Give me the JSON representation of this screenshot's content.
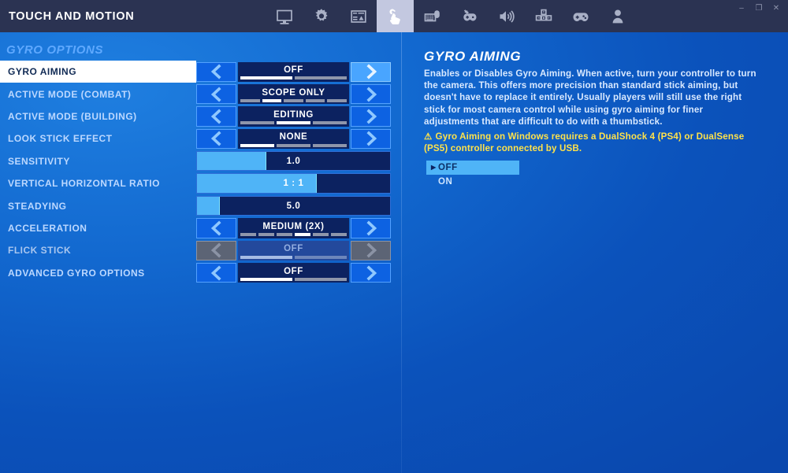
{
  "window": {
    "title": "TOUCH AND MOTION",
    "controls": [
      {
        "name": "minimize",
        "glyph": "–"
      },
      {
        "name": "maximize",
        "glyph": "❐"
      },
      {
        "name": "close",
        "glyph": "✕"
      }
    ]
  },
  "tabs": [
    {
      "icon": "monitor-icon",
      "label": "Video",
      "selected": false
    },
    {
      "icon": "gear-icon",
      "label": "Game",
      "selected": false
    },
    {
      "icon": "hud-layout-icon",
      "label": "HUD Layout",
      "selected": false
    },
    {
      "icon": "touch-hand-icon",
      "label": "Touch and Motion",
      "selected": true
    },
    {
      "icon": "keyboard-mouse-icon",
      "label": "Keyboard and Mouse",
      "selected": false
    },
    {
      "icon": "controller-settings-icon",
      "label": "Controller Settings",
      "selected": false
    },
    {
      "icon": "audio-speaker-icon",
      "label": "Audio",
      "selected": false
    },
    {
      "icon": "keybinds-icon",
      "label": "Key Bindings",
      "selected": false
    },
    {
      "icon": "gamepad-icon",
      "label": "Controller",
      "selected": false
    },
    {
      "icon": "account-person-icon",
      "label": "Account",
      "selected": false
    }
  ],
  "settings": {
    "section_title": "GYRO OPTIONS",
    "rows": [
      {
        "label": "GYRO AIMING",
        "type": "stepper",
        "value": "OFF",
        "segments": 2,
        "active_segment": 1,
        "selected": true,
        "disabled": false,
        "right_arrow_hot": true
      },
      {
        "label": "ACTIVE MODE (COMBAT)",
        "type": "stepper",
        "value": "SCOPE ONLY",
        "segments": 5,
        "active_segment": 2,
        "selected": false,
        "disabled": false,
        "right_arrow_hot": false
      },
      {
        "label": "ACTIVE MODE (BUILDING)",
        "type": "stepper",
        "value": "EDITING",
        "segments": 3,
        "active_segment": 2,
        "selected": false,
        "disabled": false,
        "right_arrow_hot": false
      },
      {
        "label": "LOOK STICK EFFECT",
        "type": "stepper",
        "value": "NONE",
        "segments": 3,
        "active_segment": 1,
        "selected": false,
        "disabled": false,
        "right_arrow_hot": false
      },
      {
        "label": "SENSITIVITY",
        "type": "slider",
        "value": "1.0",
        "fill_percent": 36,
        "selected": false,
        "disabled": false
      },
      {
        "label": "VERTICAL HORIZONTAL RATIO",
        "type": "slider",
        "value": "1 : 1",
        "fill_percent": 62,
        "selected": false,
        "disabled": false
      },
      {
        "label": "STEADYING",
        "type": "slider",
        "value": "5.0",
        "fill_percent": 12,
        "selected": false,
        "disabled": false
      },
      {
        "label": "ACCELERATION",
        "type": "stepper",
        "value": "MEDIUM (2X)",
        "segments": 6,
        "active_segment": 4,
        "selected": false,
        "disabled": false,
        "right_arrow_hot": false
      },
      {
        "label": "FLICK STICK",
        "type": "stepper",
        "value": "OFF",
        "segments": 2,
        "active_segment": 1,
        "selected": false,
        "disabled": true,
        "right_arrow_hot": false
      },
      {
        "label": "ADVANCED GYRO OPTIONS",
        "type": "stepper",
        "value": "OFF",
        "segments": 2,
        "active_segment": 1,
        "selected": false,
        "disabled": false,
        "right_arrow_hot": false
      }
    ]
  },
  "detail": {
    "title": "GYRO AIMING",
    "description": "Enables or Disables Gyro Aiming. When active, turn your controller to turn the camera. This offers more precision than standard stick aiming, but doesn't have to replace it entirely. Usually players will still use the right stick for most camera control while using gyro aiming for finer adjustments that are difficult to do with a thumbstick.",
    "warning": "Gyro Aiming on Windows requires a DualShock 4 (PS4) or DualSense (PS5) controller connected by USB.",
    "warning_icon": "warning-triangle-icon",
    "options": [
      {
        "label": "OFF",
        "selected": true
      },
      {
        "label": "ON",
        "selected": false
      }
    ]
  },
  "colors": {
    "accent_blue": "#4fb4f7",
    "panel_blue": "#0c2260",
    "arrow_blue": "#0d62e2",
    "section_header": "#5fa9ff",
    "warning_yellow": "#ffe24a",
    "titlebar": "#2b3352",
    "selected_row_bg": "#ffffff"
  }
}
